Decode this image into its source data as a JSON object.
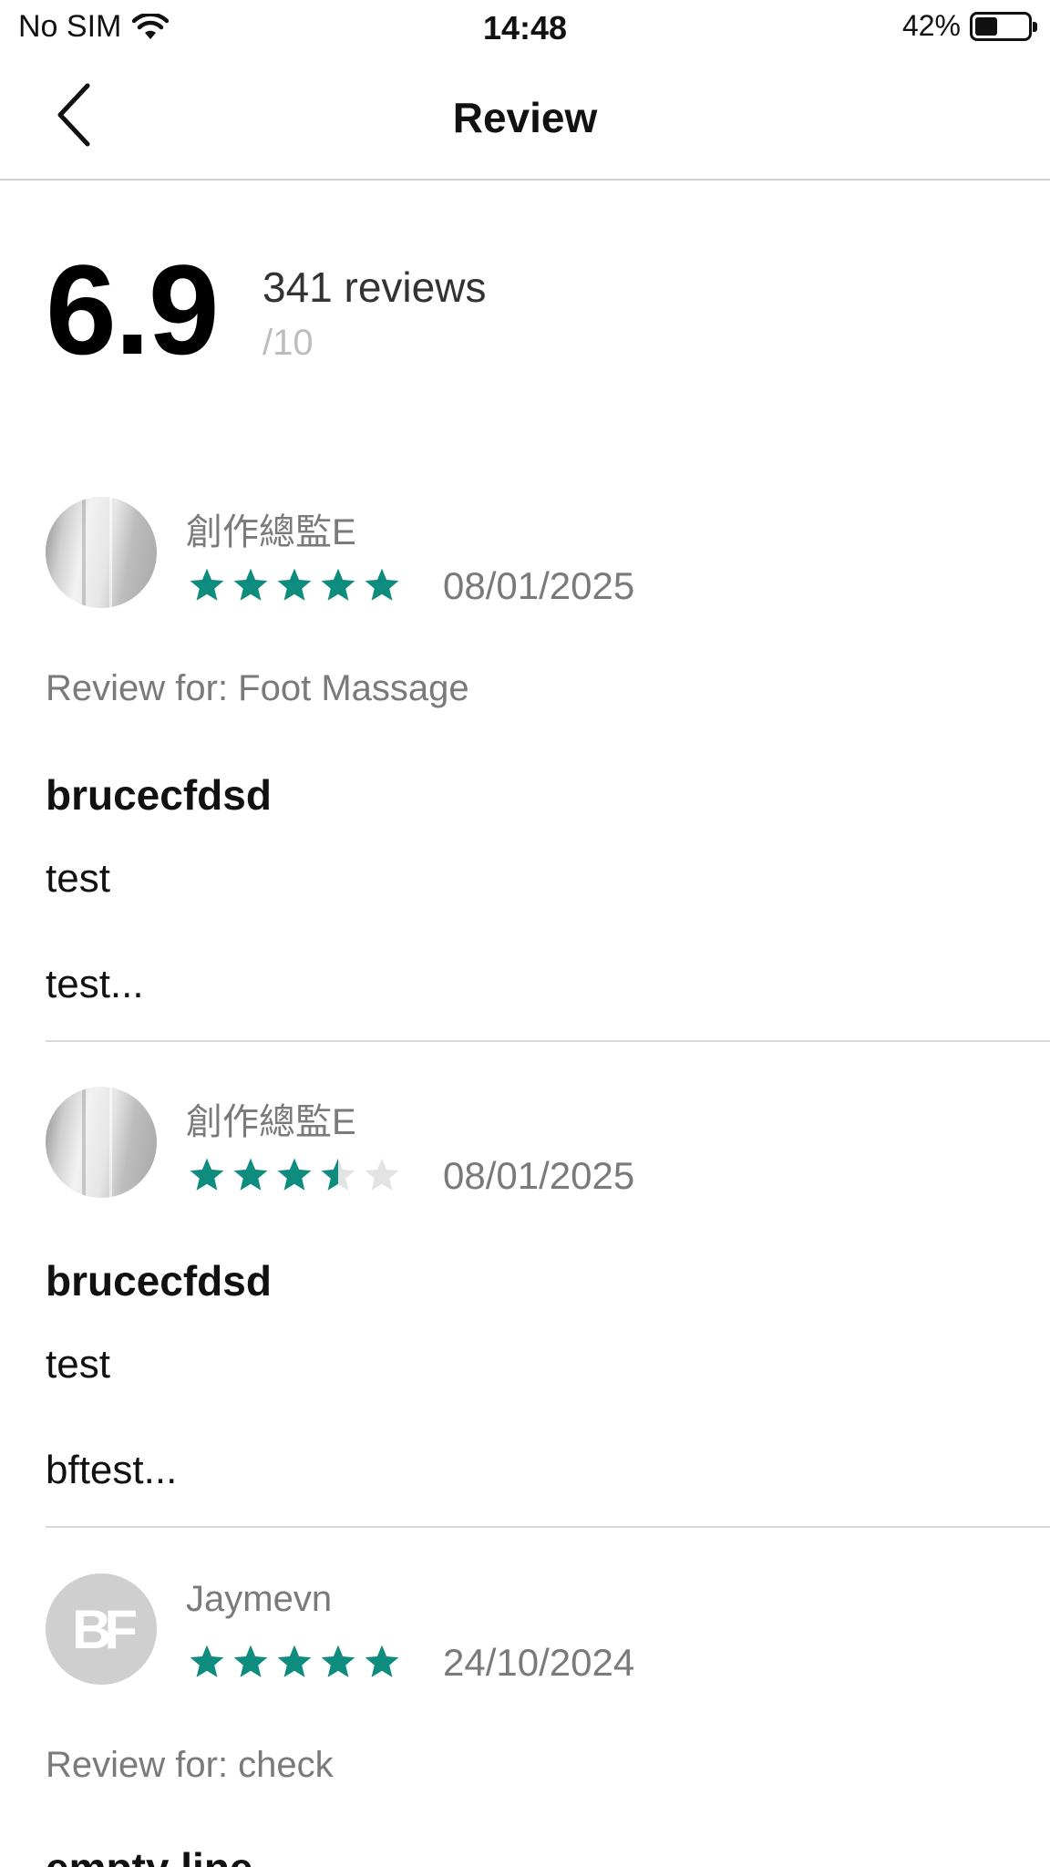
{
  "status_bar": {
    "carrier": "No SIM",
    "time": "14:48",
    "battery": "42%",
    "battery_level": 0.42
  },
  "nav": {
    "title": "Review",
    "back_icon": "chevron-left-icon"
  },
  "summary": {
    "score": "6.9",
    "review_count": "341 reviews",
    "score_max": "/10"
  },
  "colors": {
    "star_filled": "#0E8C7E",
    "star_empty": "#E3E3E3"
  },
  "reviews": [
    {
      "name": "創作總監E",
      "avatar": "photo",
      "rating": 5,
      "date": "08/01/2025",
      "review_for": "Review for: Foot Massage",
      "title": "brucecfdsd",
      "lines": [
        "test",
        "test..."
      ]
    },
    {
      "name": "創作總監E",
      "avatar": "photo",
      "rating": 3.5,
      "date": "08/01/2025",
      "title": "brucecfdsd",
      "lines": [
        "test",
        "bftest..."
      ]
    },
    {
      "name": "Jaymevn",
      "avatar": "initials",
      "avatar_initials": "BF",
      "rating": 5,
      "date": "24/10/2024",
      "review_for": "Review for: check",
      "title": "empty line"
    }
  ]
}
